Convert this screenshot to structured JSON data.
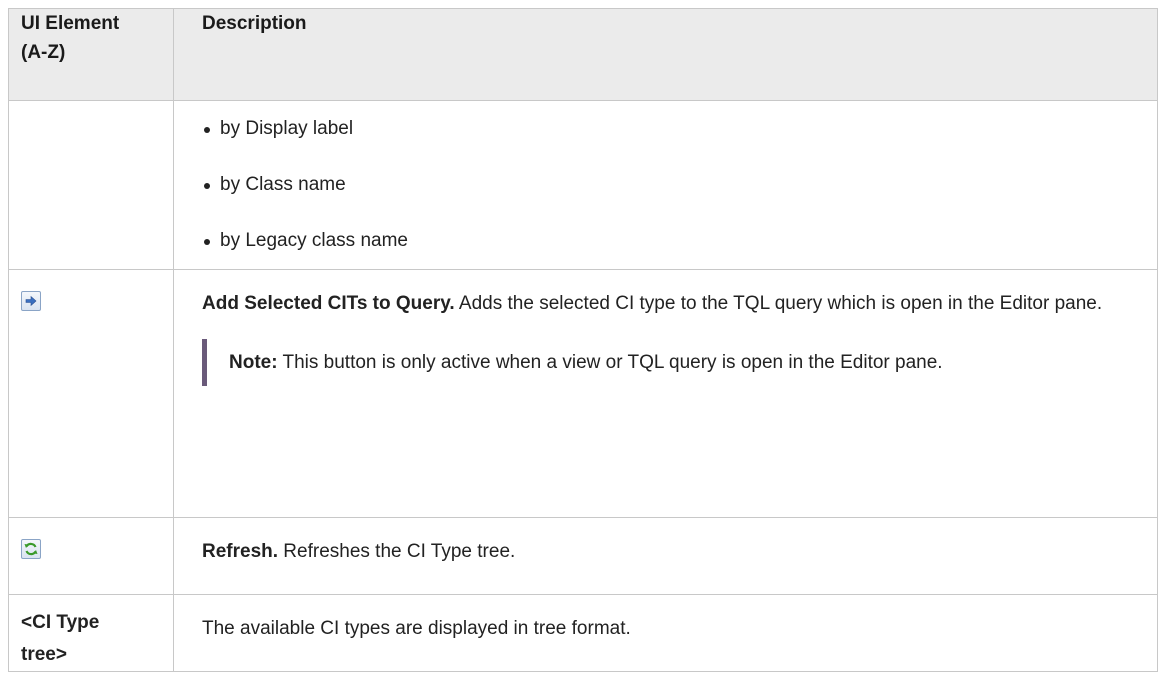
{
  "table": {
    "headers": [
      "UI Element\n(A-Z)",
      "Description"
    ],
    "header_col1_line1": "UI Element",
    "header_col1_line2": "(A-Z)",
    "header_col2": "Description",
    "rows": {
      "sort_options": {
        "element": "",
        "bullets": [
          "by Display label",
          "by Class name",
          "by Legacy class name"
        ]
      },
      "add_selected": {
        "icon": "arrow-right-icon",
        "title": "Add Selected CITs to Query.",
        "text": " Adds the selected CI type to the TQL query which is open in the Editor pane.",
        "note_label": "Note:",
        "note_text": "  This button is only active when a view or TQL query is open in the Editor pane."
      },
      "refresh": {
        "icon": "refresh-icon",
        "title": "Refresh.",
        "text": " Refreshes the CI Type tree."
      },
      "ci_type_tree": {
        "element_line1": "<CI Type",
        "element_line2": "tree>",
        "text": "The available CI types are displayed in tree format."
      }
    }
  },
  "colors": {
    "header_bg": "#ebebeb",
    "border": "#c8c8c8",
    "note_bar": "#6a5a7a",
    "refresh_green": "#3a9a2a",
    "arrow_blue": "#3a6fc0"
  }
}
